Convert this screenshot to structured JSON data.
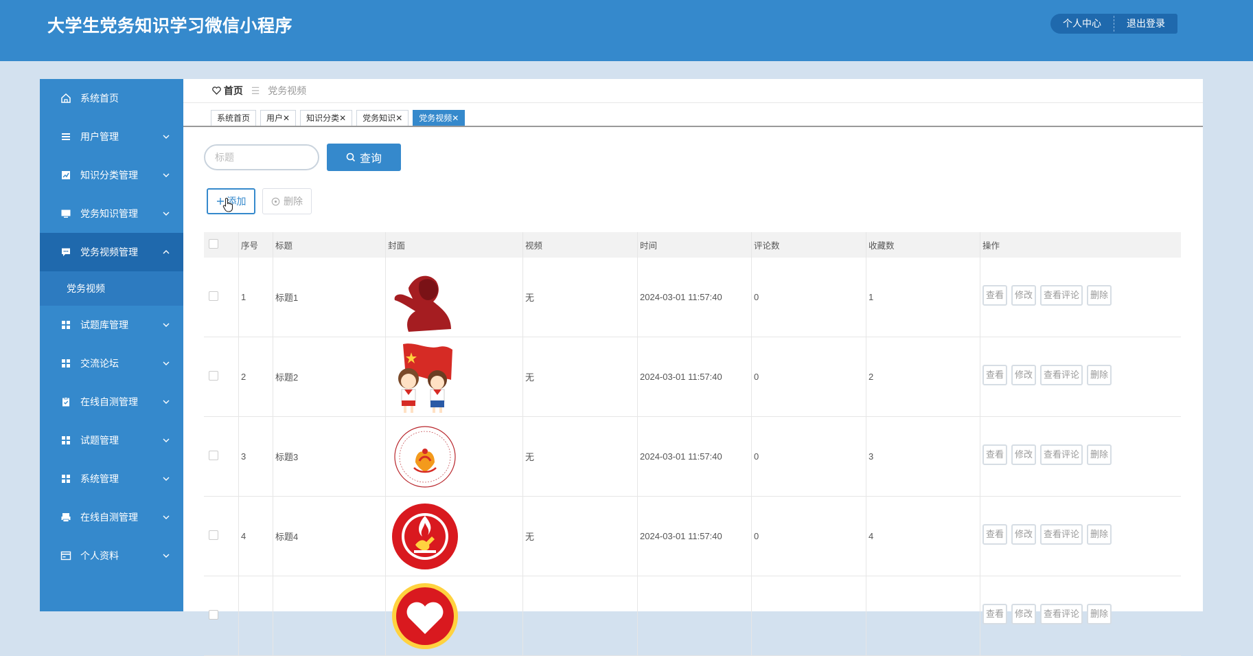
{
  "app": {
    "title": "大学生党务知识学习微信小程序"
  },
  "header": {
    "profile_label": "个人中心",
    "logout_label": "退出登录"
  },
  "sidebar": {
    "items": [
      {
        "label": "系统首页",
        "icon": "home-icon"
      },
      {
        "label": "用户管理",
        "icon": "list-icon"
      },
      {
        "label": "知识分类管理",
        "icon": "chart-icon"
      },
      {
        "label": "党务知识管理",
        "icon": "monitor-icon"
      },
      {
        "label": "党务视频管理",
        "icon": "chat-icon",
        "expanded": true
      },
      {
        "label": "试题库管理",
        "icon": "grid-icon"
      },
      {
        "label": "交流论坛",
        "icon": "grid-icon"
      },
      {
        "label": "在线自测管理",
        "icon": "clipboard-icon"
      },
      {
        "label": "试题管理",
        "icon": "grid-icon"
      },
      {
        "label": "系统管理",
        "icon": "grid-icon"
      },
      {
        "label": "在线自测管理",
        "icon": "printer-icon"
      },
      {
        "label": "个人资料",
        "icon": "card-icon"
      }
    ],
    "sub_item": "党务视频"
  },
  "breadcrumb": {
    "home": "首页",
    "divider": "☰",
    "current": "党务视频"
  },
  "tabs": [
    {
      "label": "系统首页",
      "closable": false
    },
    {
      "label": "用户",
      "closable": true
    },
    {
      "label": "知识分类",
      "closable": true
    },
    {
      "label": "党务知识",
      "closable": true
    },
    {
      "label": "党务视频",
      "closable": true,
      "active": true
    }
  ],
  "toolbar": {
    "search_placeholder": "标题",
    "query_label": "查询",
    "add_label": "添加",
    "delete_label": "删除"
  },
  "table": {
    "headers": [
      "序号",
      "标题",
      "封面",
      "视频",
      "时间",
      "评论数",
      "收藏数",
      "操作"
    ],
    "rows": [
      {
        "index": "1",
        "title": "标题1",
        "cover": "salute-silhouette",
        "video": "无",
        "time": "2024-03-01 11:57:40",
        "comments": "0",
        "favorites": "1"
      },
      {
        "index": "2",
        "title": "标题2",
        "cover": "children-with-flag",
        "video": "无",
        "time": "2024-03-01 11:57:40",
        "comments": "0",
        "favorites": "2"
      },
      {
        "index": "3",
        "title": "标题3",
        "cover": "volunteer-badge",
        "video": "无",
        "time": "2024-03-01 11:57:40",
        "comments": "0",
        "favorites": "3"
      },
      {
        "index": "4",
        "title": "标题4",
        "cover": "red-emblem",
        "video": "无",
        "time": "2024-03-01 11:57:40",
        "comments": "0",
        "favorites": "4"
      },
      {
        "index": "",
        "title": "",
        "cover": "heart-emblem",
        "video": "",
        "time": "",
        "comments": "",
        "favorites": ""
      }
    ],
    "row_actions": [
      "查看",
      "修改",
      "查看评论",
      "删除"
    ],
    "colors": {
      "header_bg": "#f2f2f2",
      "accent": "#3589cc"
    }
  }
}
